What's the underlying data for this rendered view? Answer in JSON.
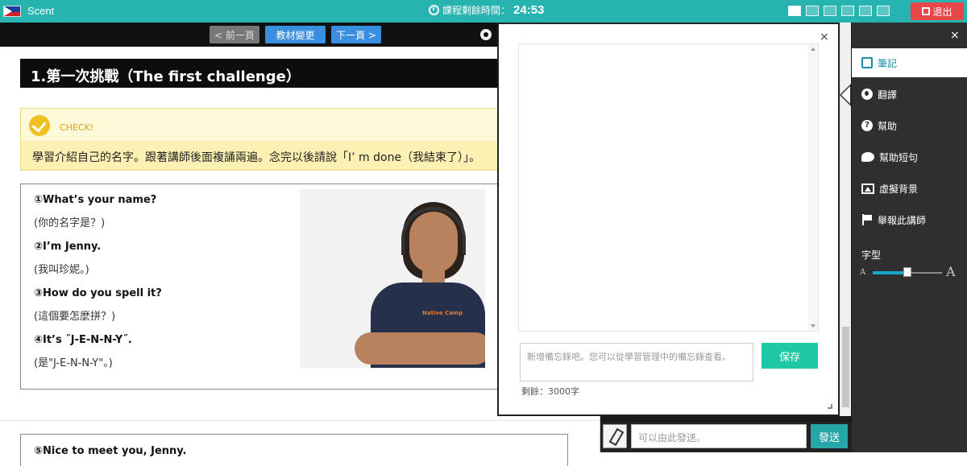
{
  "topbar": {
    "app_name": "Scent",
    "timer_label": "課程剩餘時間：",
    "timer_value": "24:53",
    "logout_label": "退出",
    "brand_color": "#27b3b0"
  },
  "nav": {
    "prev_label": "< 前一頁",
    "change_label": "教材變更",
    "next_label": "下一頁 >"
  },
  "lesson": {
    "title": "1.第一次挑戰（The first challenge）",
    "check_label": "CHECK!",
    "instruction": "學習介紹自己的名字。跟著講師後面複誦兩遍。念完以後請說「I’ m done（我結束了）」。",
    "lines": [
      {
        "en": "①What’s your name?",
        "zh": "(你的名字是？)"
      },
      {
        "en": "②I’m Jenny.",
        "zh": "(我叫珍妮。)"
      },
      {
        "en": "③How do you spell it?",
        "zh": "(這個要怎麼拼？)"
      },
      {
        "en": "④It’s ˝J-E-N-N-Y˝.",
        "zh": "(是\"J-E-N-N-Y\"。)"
      }
    ],
    "next_line": "⑤Nice to meet you, Jenny.",
    "photo_logo": "Native Camp"
  },
  "memo": {
    "placeholder": "新增備忘錄吧。您可以從學習管理中的備忘錄查看。",
    "save_label": "保存",
    "remaining": "剩餘：3000字"
  },
  "chat": {
    "placeholder": "可以由此發送。",
    "send_label": "發送"
  },
  "sidebar": {
    "items": [
      {
        "label": "筆記",
        "icon": "edit-icon"
      },
      {
        "label": "翻譯",
        "icon": "globe-icon"
      },
      {
        "label": "幫助",
        "icon": "help-icon"
      },
      {
        "label": "幫助短句",
        "icon": "chat-bubble-icon"
      },
      {
        "label": "虛擬背景",
        "icon": "image-icon"
      },
      {
        "label": "舉報此講師",
        "icon": "flag-icon"
      }
    ],
    "font_label": "字型",
    "font_size_fraction": 0.5,
    "font_small": "A",
    "font_big": "A"
  }
}
